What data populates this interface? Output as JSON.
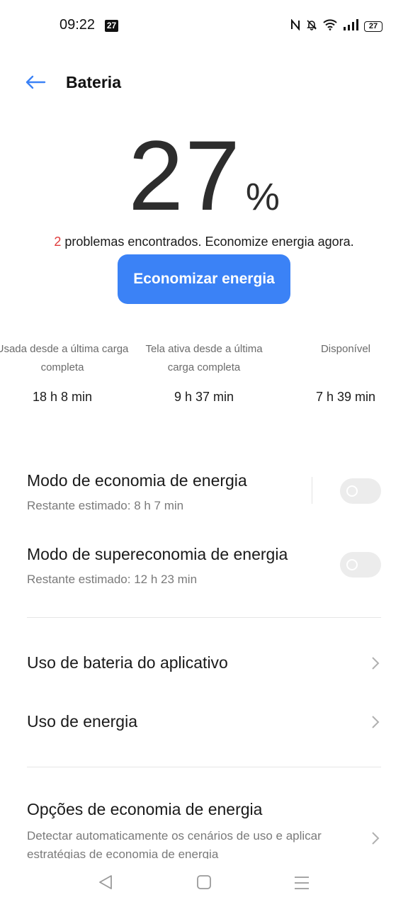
{
  "status_bar": {
    "time": "09:22",
    "notification_badge": "27",
    "battery_level": "27",
    "icons": [
      "nfc-icon",
      "bell-off-icon",
      "wifi-icon",
      "signal-icon",
      "battery-icon"
    ]
  },
  "header": {
    "title": "Bateria",
    "back_icon": "back-arrow-icon"
  },
  "battery": {
    "percent": "27",
    "percent_sign": "%",
    "problems_count": "2",
    "problems_text": " problemas encontrados. Economize energia agora.",
    "save_button": "Economizar energia"
  },
  "stats": [
    {
      "label": "Usada desde a última carga completa",
      "value": "18 h 8 min"
    },
    {
      "label": "Tela ativa desde a última carga completa",
      "value": "9 h 37 min"
    },
    {
      "label": "Disponível",
      "value": "7 h 39 min"
    }
  ],
  "modes": [
    {
      "title": "Modo de economia de energia",
      "subtitle": "Restante estimado:  8 h 7 min",
      "enabled": false
    },
    {
      "title": "Modo de supereconomia de energia",
      "subtitle": "Restante estimado:  12 h 23 min",
      "enabled": false
    }
  ],
  "menu": [
    {
      "title": "Uso de bateria do aplicativo"
    },
    {
      "title": "Uso de energia"
    },
    {
      "title": "Opções de economia de energia",
      "subtitle": "Detectar automaticamente os cenários de uso e aplicar estratégias de economia de energia"
    }
  ],
  "nav": {
    "icons": [
      "nav-back-icon",
      "nav-home-icon",
      "nav-menu-icon"
    ]
  },
  "colors": {
    "accent": "#3b82f6",
    "warning": "#e03b3b"
  }
}
